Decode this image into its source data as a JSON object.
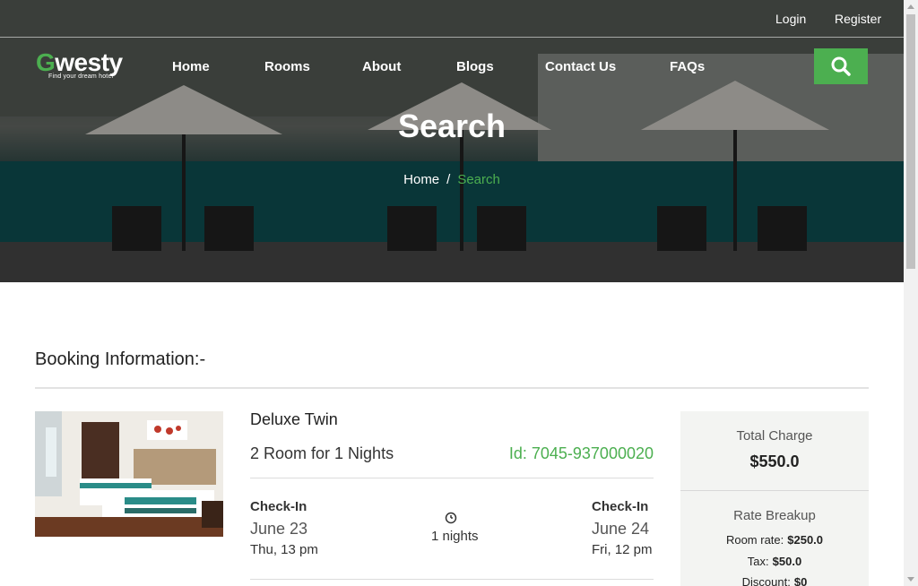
{
  "topbar": {
    "login": "Login",
    "register": "Register"
  },
  "logo": {
    "brand_g": "G",
    "brand_rest": "westy",
    "tagline": "Find your dream hotel"
  },
  "nav": {
    "items": [
      "Home",
      "Rooms",
      "About",
      "Blogs",
      "Contact Us",
      "FAQs"
    ]
  },
  "hero": {
    "title": "Search",
    "breadcrumb_home": "Home",
    "breadcrumb_sep": "/",
    "breadcrumb_current": "Search"
  },
  "booking": {
    "section_title": "Booking Information:-",
    "room_name": "Deluxe Twin",
    "room_count": "2 Room for 1 Nights",
    "booking_id": "Id: 7045-937000020",
    "checkin_left": {
      "label": "Check-In",
      "date": "June 23",
      "day": "Thu, 13 pm"
    },
    "checkin_right": {
      "label": "Check-In",
      "date": "June 24",
      "day": "Fri, 12 pm"
    },
    "nights": "1 nights"
  },
  "charges": {
    "total_label": "Total Charge",
    "total_value": "$550.0",
    "breakup_label": "Rate Breakup",
    "room_rate_label": "Room rate:",
    "room_rate_value": "$250.0",
    "tax_label": "Tax:",
    "tax_value": "$50.0",
    "discount_label": "Discount:",
    "discount_value": "$0"
  },
  "icons": {
    "search": "search-icon",
    "clock": "clock-icon"
  },
  "colors": {
    "accent": "#4caf50"
  }
}
